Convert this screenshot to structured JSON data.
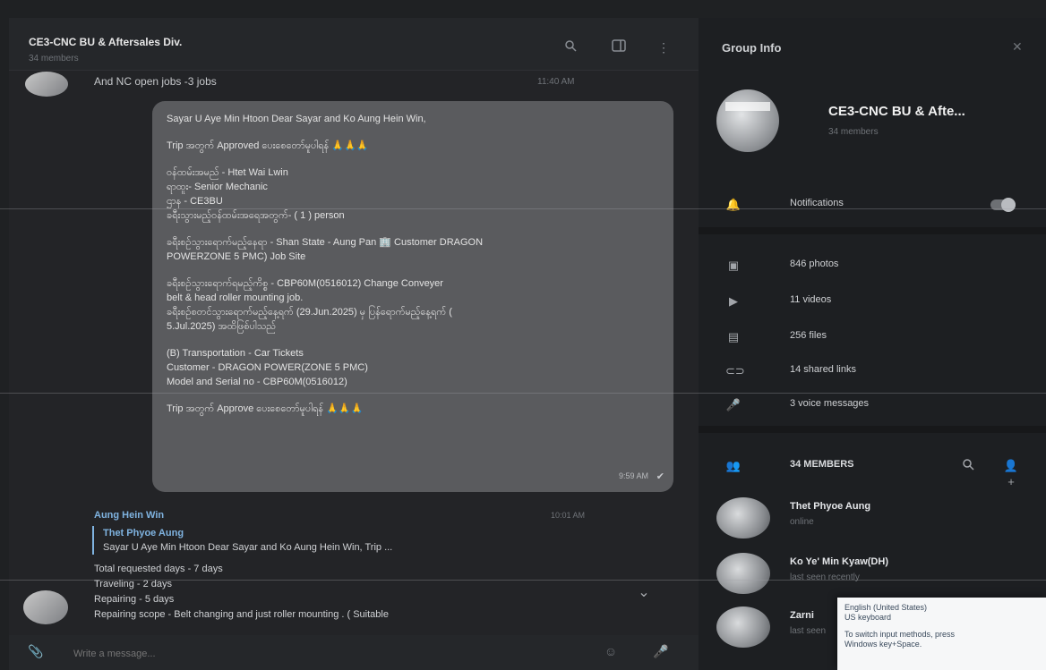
{
  "chat": {
    "title": "CE3-CNC BU & Aftersales Div.",
    "subtitle": "34 members",
    "preview": {
      "text": "And NC open jobs -3 jobs",
      "time": "11:40 AM"
    },
    "bubble": {
      "lines": [
        "Sayar U Aye Min Htoon  Dear Sayar and Ko Aung Hein Win,",
        "",
        "Trip အတွက် Approved ပေးစေတော်မူပါရန် 🙏🙏🙏",
        "",
        "ဝန်ထမ်းအမည် - Htet Wai Lwin",
        "ရာထူး- Senior Mechanic",
        "ဌာန - CE3BU",
        "ခရီးသွားမည့်ဝန်ထမ်းအရေအတွက်- ( 1 ) person",
        "",
        "ခရီးစဉ်သွားရောက်မည့်နေရာ - Shan State - Aung Pan 🏢 Customer  DRAGON",
        "POWERZONE 5 PMC) Job Site",
        "",
        "ခရီးစဉ်သွားရောက်ရမည့်ကိစ္စ - CBP60M(0516012) Change Conveyer",
        "belt & head roller mounting job.",
        "ခရီးစဉ်စတင်သွားရောက်မည့်နေ့ရက် (29.Jun.2025) မှ ပြန်ရောက်မည့်နေ့ရက် (",
        "5.Jul.2025) အထိဖြစ်ပါသည်",
        "",
        "(B) Transportation - Car Tickets",
        "Customer  - DRAGON POWER(ZONE 5 PMC)",
        "Model and Serial no - CBP60M(0516012)",
        "",
        "Trip အတွက် Approve ပေးစေတော်မူပါရန် 🙏🙏🙏"
      ],
      "time": "9:59 AM"
    },
    "reply": {
      "sender": "Aung Hein Win",
      "time": "10:01 AM",
      "quote_name": "Thet Phyoe Aung",
      "quote_text": "Sayar U Aye Min Htoon  Dear Sayar and Ko Aung Hein Win,  Trip ...",
      "body": [
        "Total requested days - 7 days",
        "Traveling - 2 days",
        "Repairing - 5 days",
        "Repairing scope - Belt changing and just roller mounting . ( Suitable"
      ]
    },
    "composer_placeholder": "Write a message..."
  },
  "info": {
    "title": "Group Info",
    "group_name": "CE3-CNC BU & Afte...",
    "group_sub": "34 members",
    "rows": {
      "notifications": "Notifications",
      "photos": "846 photos",
      "videos": "11 videos",
      "files": "256 files",
      "links": "14 shared links",
      "voice": "3 voice messages"
    },
    "members_label": "34 MEMBERS",
    "members": [
      {
        "name": "Thet Phyoe Aung",
        "status": "online"
      },
      {
        "name": "Ko Ye' Min Kyaw(DH)",
        "status": "last seen recently"
      },
      {
        "name": "Zarni",
        "status": "last seen"
      }
    ]
  },
  "ime": {
    "line1": "English (United States)",
    "line2": "US keyboard",
    "line3": "To switch input methods, press",
    "line4": "Windows key+Space."
  },
  "icons": {
    "search": "search-icon",
    "sidebar": "sidebar-toggle-icon",
    "more": "more-icon",
    "bell": "bell-icon",
    "photo": "photo-icon",
    "video": "video-icon",
    "file": "file-icon",
    "link": "link-icon",
    "mic": "mic-icon",
    "members": "members-icon",
    "add_member": "add-member-icon"
  }
}
